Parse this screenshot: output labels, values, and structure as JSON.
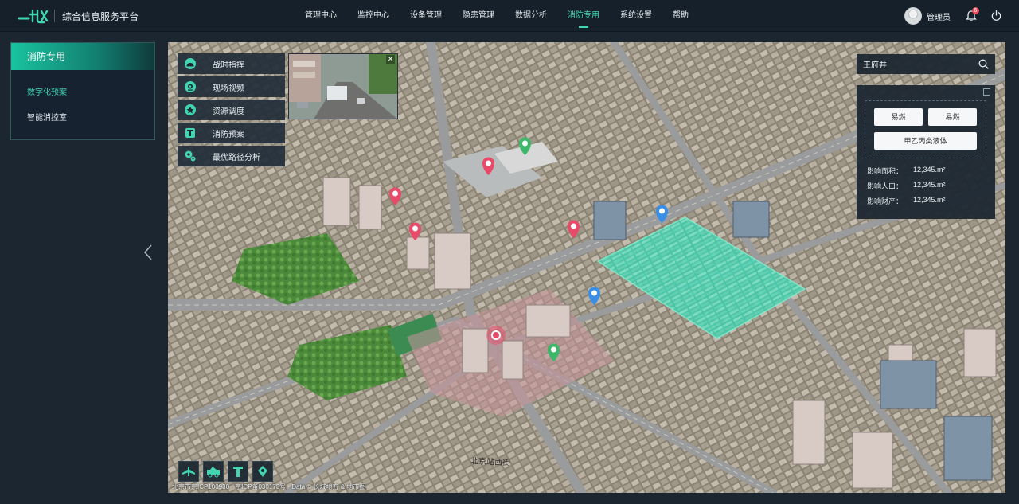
{
  "header": {
    "app_title": "综合信息服务平台",
    "nav": [
      {
        "label": "管理中心"
      },
      {
        "label": "监控中心"
      },
      {
        "label": "设备管理"
      },
      {
        "label": "隐患管理"
      },
      {
        "label": "数据分析"
      },
      {
        "label": "消防专用",
        "active": true
      },
      {
        "label": "系统设置"
      },
      {
        "label": "帮助"
      }
    ],
    "user_name": "管理员",
    "notification_count": "6"
  },
  "sidebar": {
    "title": "消防专用",
    "items": [
      {
        "label": "数字化预案",
        "active": true
      },
      {
        "label": "智能消控室"
      }
    ]
  },
  "map": {
    "tools": [
      {
        "label": "战时指挥",
        "icon": "helmet-icon"
      },
      {
        "label": "现场视频",
        "icon": "camera-icon"
      },
      {
        "label": "资源调度",
        "icon": "resource-icon"
      },
      {
        "label": "消防预案",
        "icon": "plan-icon"
      },
      {
        "label": "最优路径分析",
        "icon": "route-icon"
      }
    ],
    "search": {
      "value": "王府井",
      "placeholder": ""
    },
    "info_panel": {
      "tags": [
        "易燃",
        "易燃",
        "甲乙丙类液体"
      ],
      "stats": [
        {
          "label": "影响面积：",
          "value": "12,345.m²"
        },
        {
          "label": "影响人口：",
          "value": "12,345.m²"
        },
        {
          "label": "影响财产：",
          "value": "12,345.m²"
        }
      ]
    },
    "street_label": "北京站西街",
    "attribution": "北京市京ICP100930 · 京ICP备030173号 · Data © 长城地方 & 地市图"
  },
  "colors": {
    "accent": "#41d5b2",
    "header_bg": "#16202a",
    "panel_bg": "#1c2731",
    "marker_red": "#e84a6a",
    "marker_green": "#3db86a",
    "marker_blue": "#3a8ee6",
    "highlight_zone": "#38d8b0"
  }
}
